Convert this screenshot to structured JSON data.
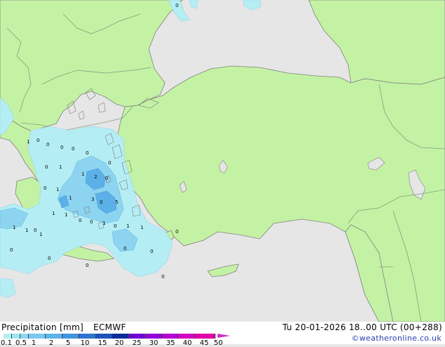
{
  "header": {
    "title": "Precipitation [mm]",
    "model": "ECMWF",
    "datetime": "Tu 20-01-2026 18..00 UTC (00+288)"
  },
  "credit": "©weatheronline.co.uk",
  "legend": {
    "ticks": [
      "0.1",
      "0.5",
      "1",
      "2",
      "5",
      "10",
      "15",
      "20",
      "25",
      "30",
      "35",
      "40",
      "45",
      "50"
    ],
    "colors": [
      "#b4f0f0",
      "#a0e4f4",
      "#8cd8f4",
      "#78c8f0",
      "#5cb4ec",
      "#4094dc",
      "#2c74d0",
      "#1c54bc",
      "#0c2c9c",
      "#6c00d0",
      "#9000d8",
      "#b400d0",
      "#d400c8",
      "#e000a8"
    ]
  },
  "map": {
    "colors": {
      "sea": "#e6e6e6",
      "land": "#c4f2a4",
      "border": "#7f9f7f",
      "coast": "#808080",
      "precip_light": "#b4eef4",
      "precip_mid": "#8cd4f0",
      "precip_heavy": "#5cb0e8"
    },
    "point_labels": [
      "0",
      "1",
      "0",
      "0",
      "0",
      "0",
      "0",
      "1",
      "0",
      "0",
      "1",
      "0",
      "1",
      "2",
      "0",
      "1",
      "3",
      "0",
      "5",
      "1",
      "1",
      "0",
      "0",
      "1",
      "0",
      "1",
      "1",
      "1",
      "1",
      "0",
      "1",
      "0",
      "0",
      "0",
      "0",
      "0",
      "0",
      "0"
    ]
  }
}
